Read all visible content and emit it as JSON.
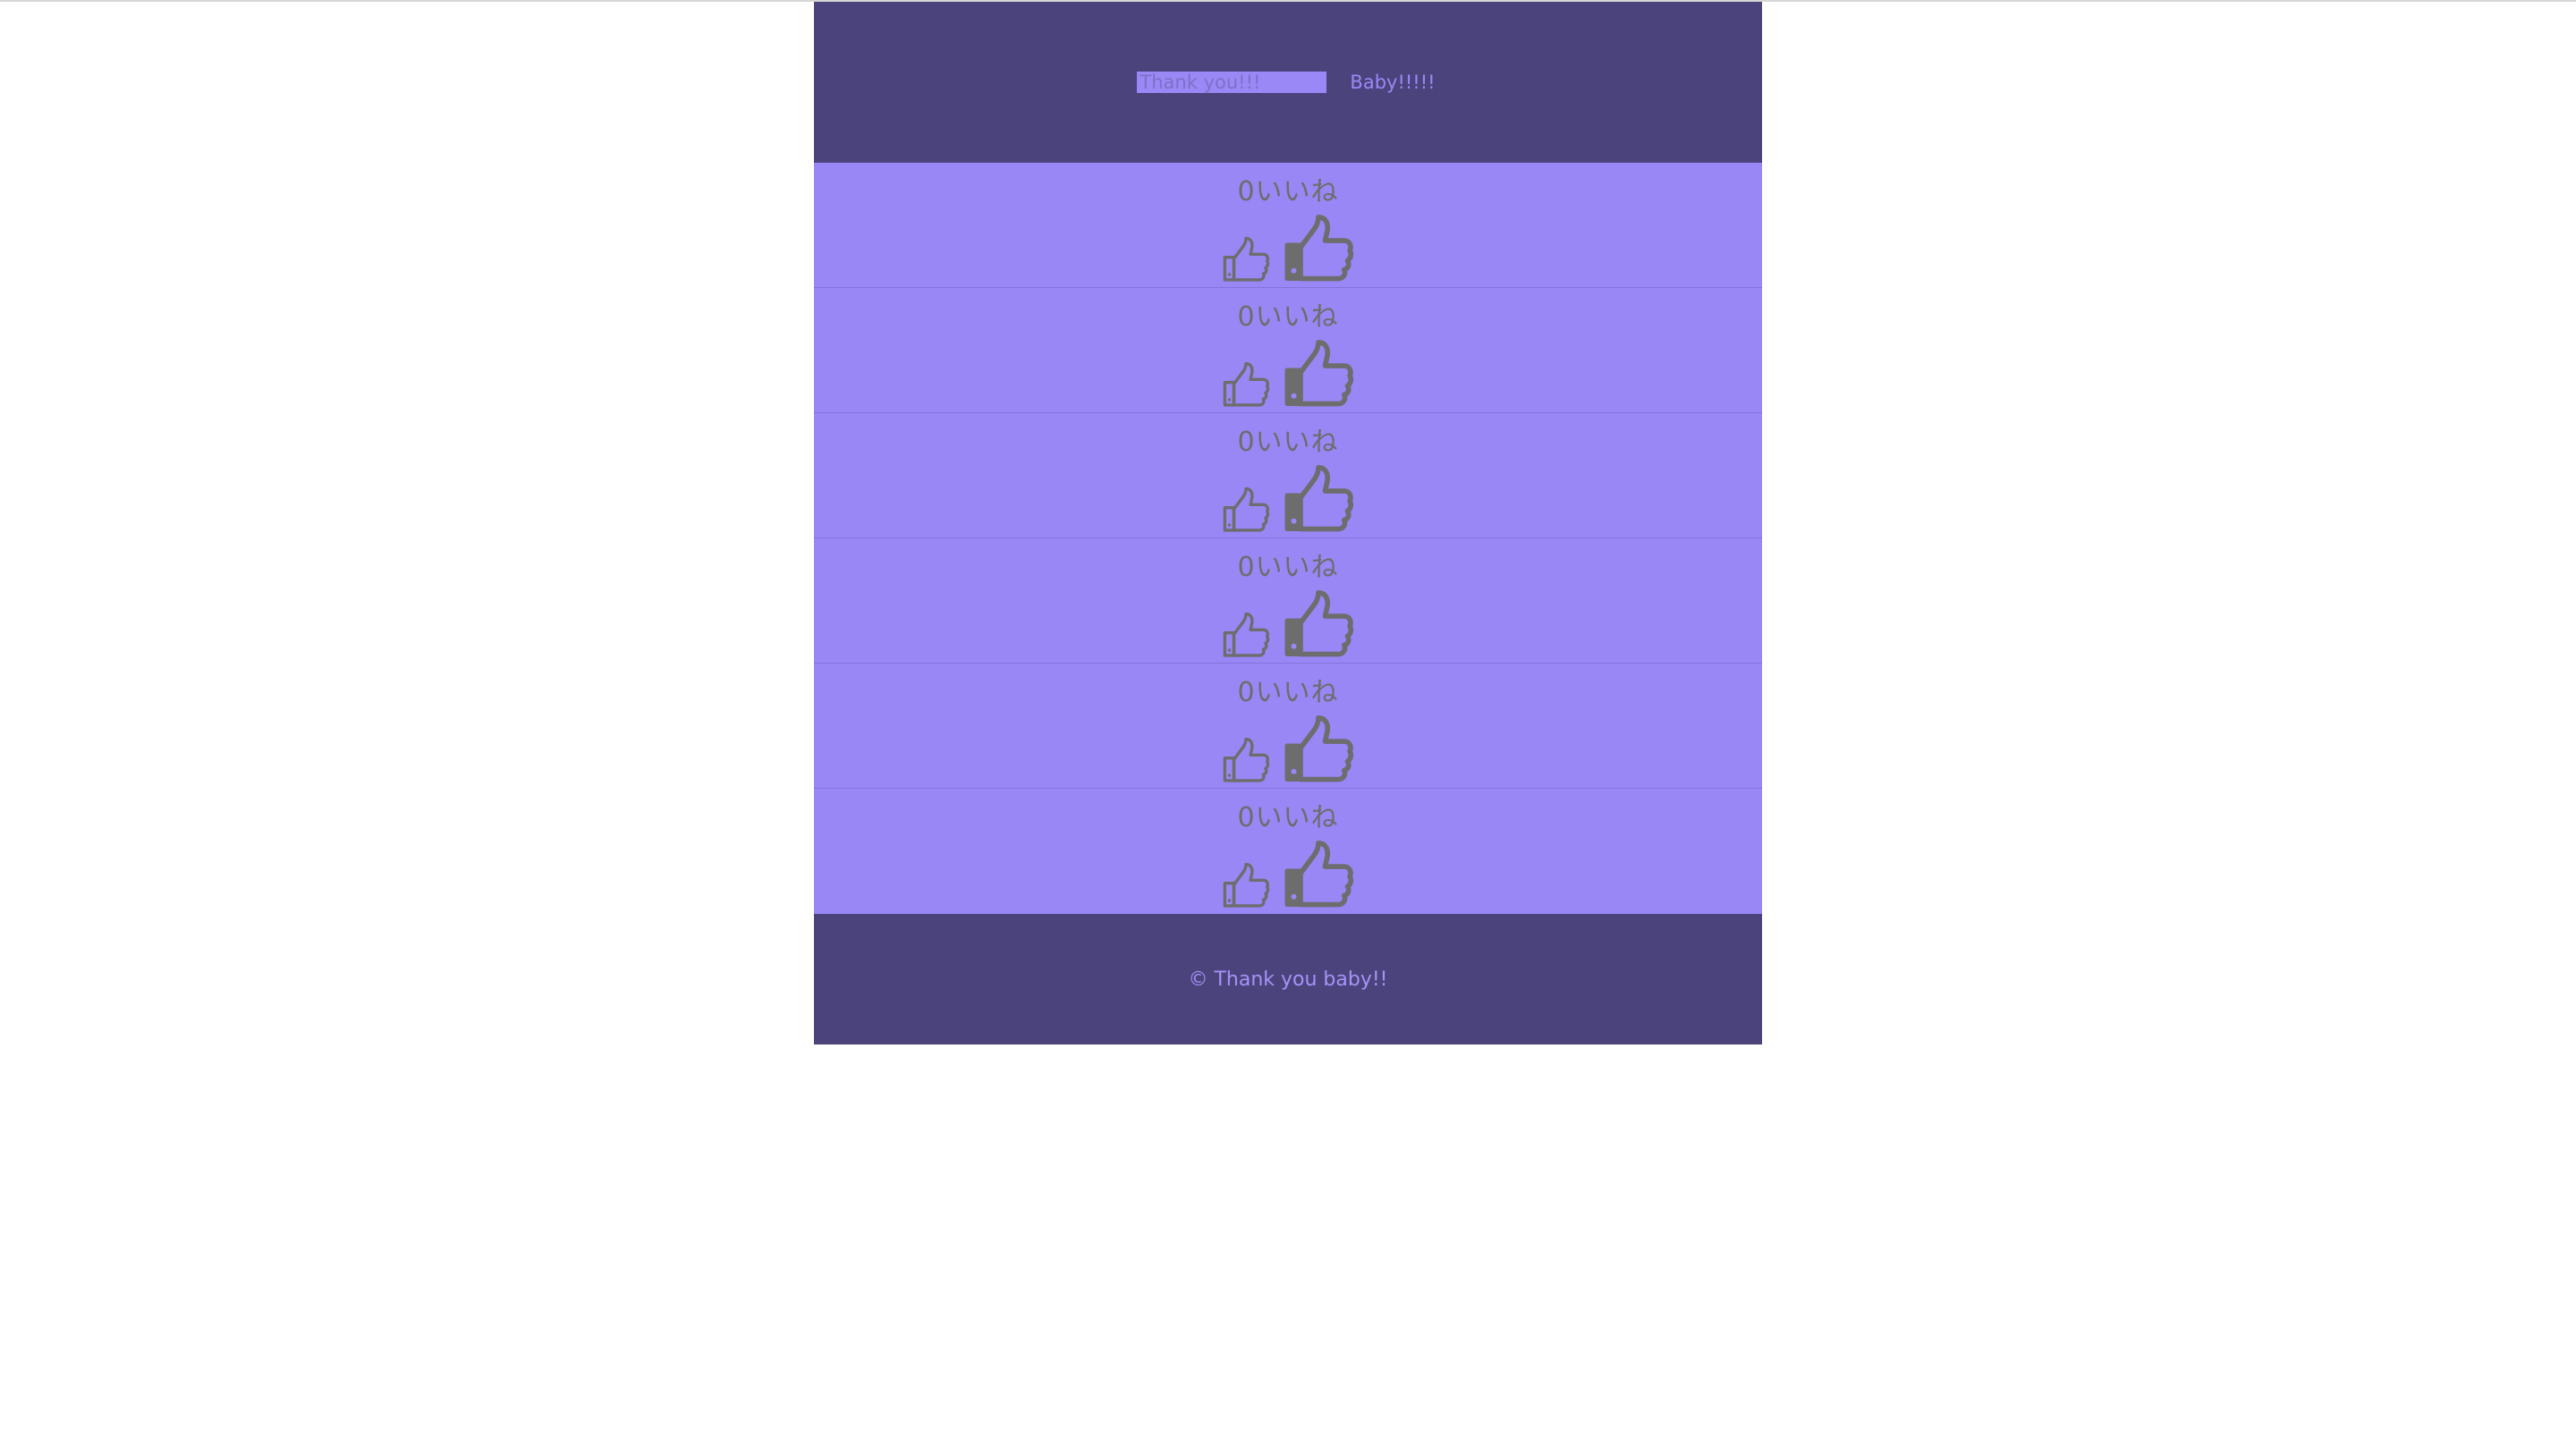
{
  "header": {
    "search_value": "Thank you!!!",
    "button_label": "Baby!!!!!"
  },
  "posts": [
    {
      "likes_label": "0いいね"
    },
    {
      "likes_label": "0いいね"
    },
    {
      "likes_label": "0いいね"
    },
    {
      "likes_label": "0いいね"
    },
    {
      "likes_label": "0いいね"
    },
    {
      "likes_label": "0いいね"
    }
  ],
  "footer": {
    "copyright": "© Thank you baby!!"
  },
  "colors": {
    "header_bg": "#4b437b",
    "list_bg": "#9987f6",
    "accent": "#9b88f7",
    "icon": "#6d6d6d"
  },
  "icons": {
    "small": "thumbs-up-icon",
    "big": "thumbs-up-icon"
  }
}
